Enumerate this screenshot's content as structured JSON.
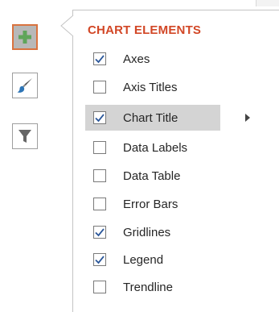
{
  "panel": {
    "title": "CHART ELEMENTS"
  },
  "side_buttons": [
    {
      "icon": "plus-icon",
      "active": true
    },
    {
      "icon": "paintbrush-icon",
      "active": false
    },
    {
      "icon": "filter-icon",
      "active": false
    }
  ],
  "items": [
    {
      "label": "Axes",
      "checked": true,
      "highlighted": false
    },
    {
      "label": "Axis Titles",
      "checked": false,
      "highlighted": false
    },
    {
      "label": "Chart Title",
      "checked": true,
      "highlighted": true
    },
    {
      "label": "Data Labels",
      "checked": false,
      "highlighted": false
    },
    {
      "label": "Data Table",
      "checked": false,
      "highlighted": false
    },
    {
      "label": "Error Bars",
      "checked": false,
      "highlighted": false
    },
    {
      "label": "Gridlines",
      "checked": true,
      "highlighted": false
    },
    {
      "label": "Legend",
      "checked": true,
      "highlighted": false
    },
    {
      "label": "Trendline",
      "checked": false,
      "highlighted": false
    }
  ],
  "colors": {
    "accent": "#d24726",
    "plus_green": "#5fa55a",
    "check_blue": "#2b579a",
    "brush_blue": "#2e75b6",
    "highlight": "#d4d4d4"
  }
}
